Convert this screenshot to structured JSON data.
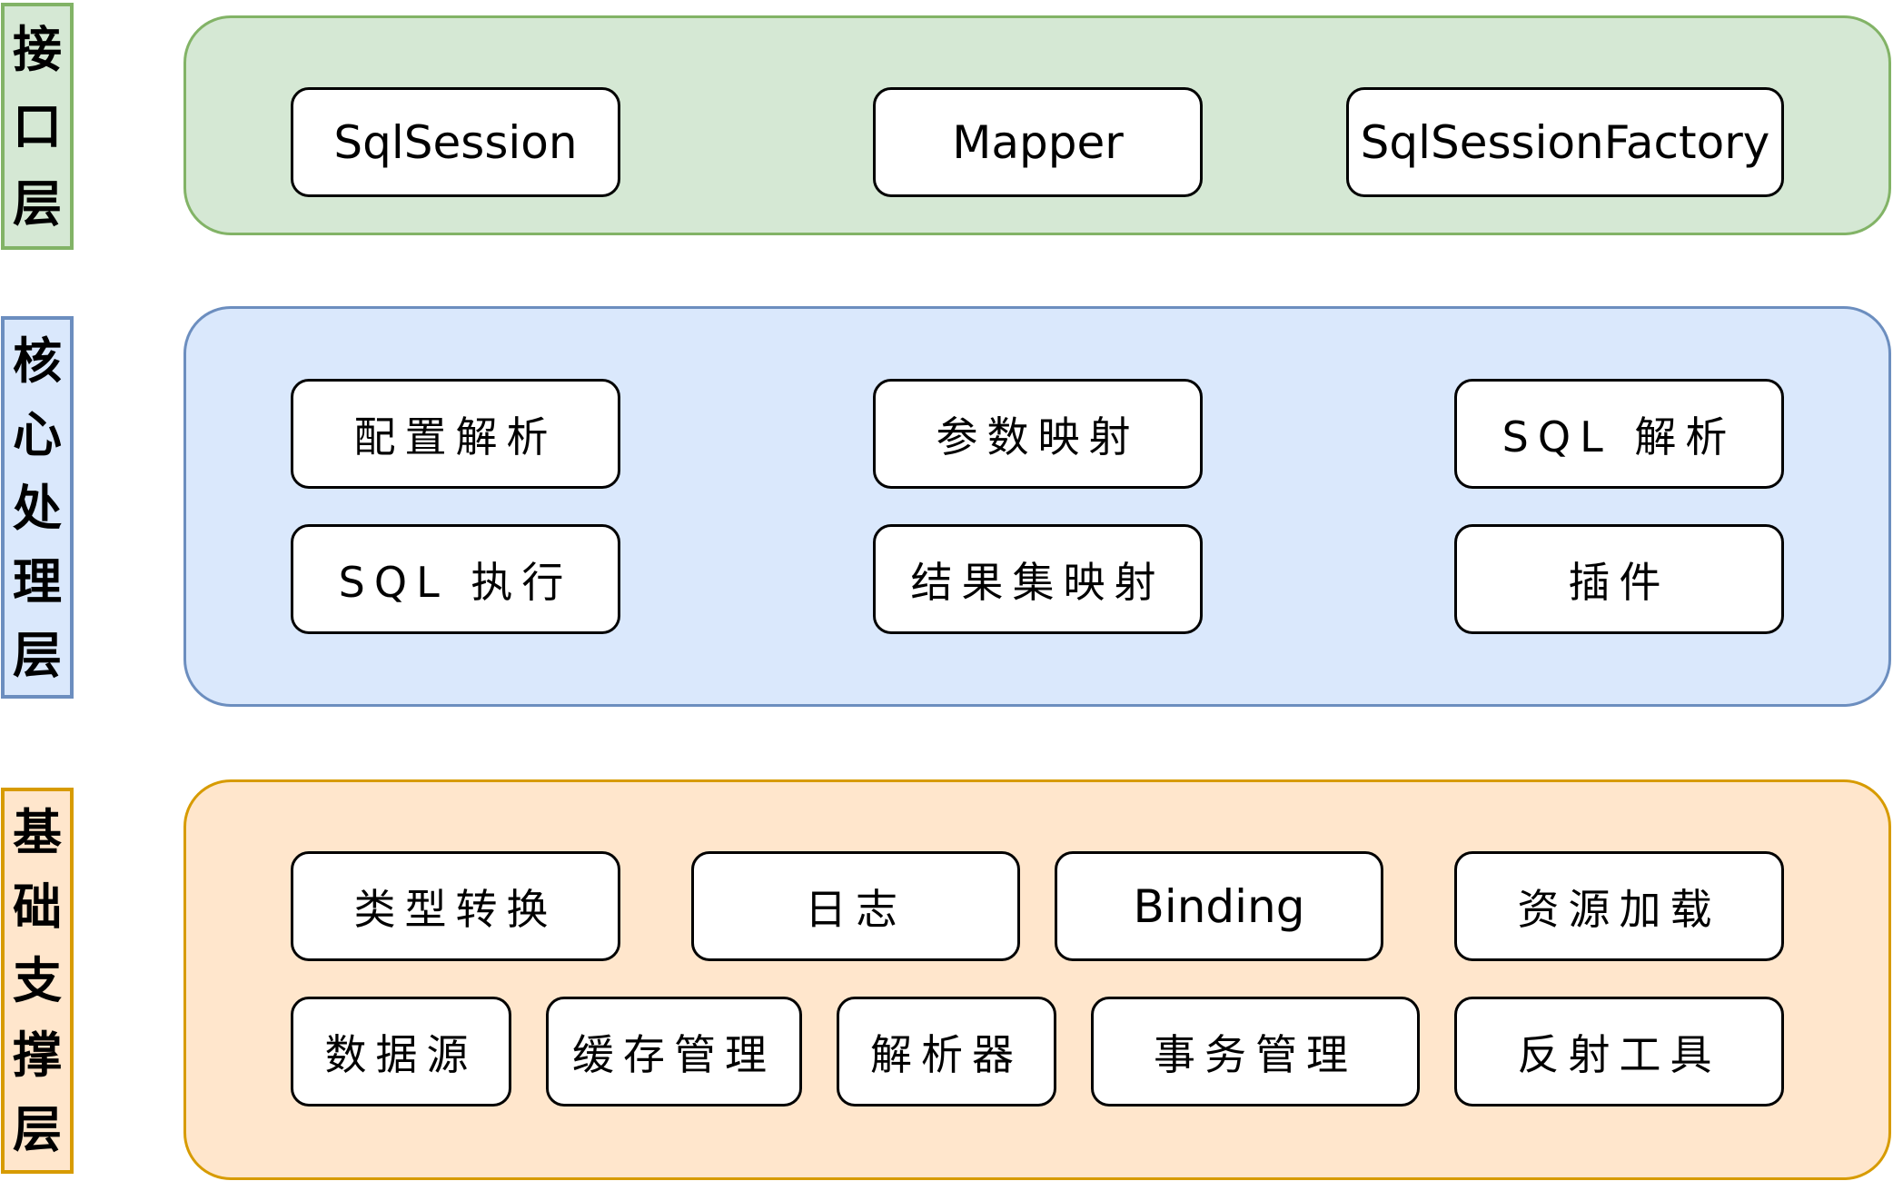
{
  "layers": {
    "interface": {
      "label": [
        "接",
        "口",
        "层"
      ],
      "fill": "#d5e8d4",
      "border": "#82b366",
      "items": [
        "SqlSession",
        "Mapper",
        "SqlSessionFactory"
      ]
    },
    "core": {
      "label": [
        "核",
        "心",
        "处",
        "理",
        "层"
      ],
      "fill": "#dae8fc",
      "border": "#6c8ebf",
      "items": [
        "配置解析",
        "参数映射",
        "SQL 解析",
        "SQL 执行",
        "结果集映射",
        "插件"
      ]
    },
    "foundation": {
      "label": [
        "基",
        "础",
        "支",
        "撑",
        "层"
      ],
      "fill": "#ffe6cc",
      "border": "#d79b00",
      "items": [
        "类型转换",
        "日志",
        "Binding",
        "资源加载",
        "数据源",
        "缓存管理",
        "解析器",
        "事务管理",
        "反射工具"
      ]
    }
  }
}
